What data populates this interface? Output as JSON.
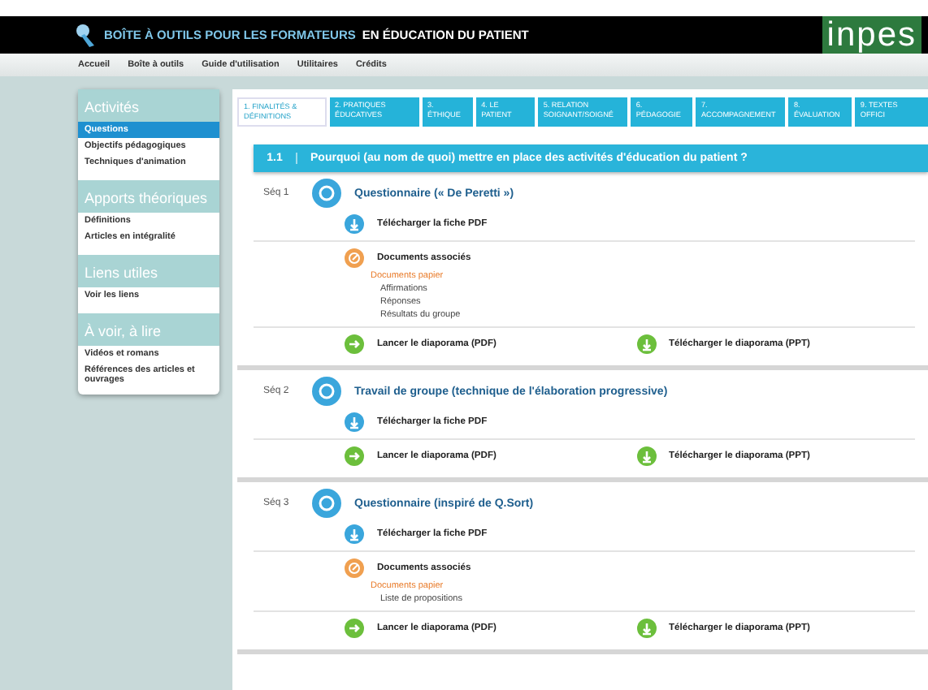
{
  "header": {
    "title_lead": "BOÎTE À OUTILS POUR LES FORMATEURS",
    "title_rest": "EN ÉDUCATION DU PATIENT",
    "logo": "inpes"
  },
  "nav": [
    "Accueil",
    "Boîte à outils",
    "Guide d'utilisation",
    "Utilitaires",
    "Crédits"
  ],
  "sidebar": [
    {
      "heading": "Activités",
      "items": [
        {
          "label": "Questions",
          "selected": true
        },
        {
          "label": "Objectifs pédagogiques",
          "selected": false
        },
        {
          "label": "Techniques d'animation",
          "selected": false
        }
      ]
    },
    {
      "heading": "Apports théoriques",
      "items": [
        {
          "label": "Définitions",
          "selected": false
        },
        {
          "label": "Articles en intégralité",
          "selected": false
        }
      ]
    },
    {
      "heading": "Liens utiles",
      "items": [
        {
          "label": "Voir les liens",
          "selected": false
        }
      ]
    },
    {
      "heading": "À voir, à lire",
      "items": [
        {
          "label": "Vidéos et romans",
          "selected": false
        },
        {
          "label": "Références des articles et ouvrages",
          "selected": false
        }
      ]
    }
  ],
  "tabs": [
    {
      "label": "1. FINALITÉS & DÉFINITIONS",
      "selected": true
    },
    {
      "label": "2. PRATIQUES ÉDUCATIVES",
      "selected": false
    },
    {
      "label": "3. ÉTHIQUE",
      "selected": false
    },
    {
      "label": "4. LE PATIENT",
      "selected": false
    },
    {
      "label": "5. RELATION SOIGNANT/SOIGNÉ",
      "selected": false
    },
    {
      "label": "6. PÉDAGOGIE",
      "selected": false
    },
    {
      "label": "7. ACCOMPAGNEMENT",
      "selected": false
    },
    {
      "label": "8. ÉVALUATION",
      "selected": false
    },
    {
      "label": "9. TEXTES OFFICI",
      "selected": false
    }
  ],
  "question": {
    "number": "1.1",
    "text": "Pourquoi (au nom de quoi) mettre en place des activités d'éducation du patient ?"
  },
  "sequences": [
    {
      "label": "Séq 1",
      "title": "Questionnaire (« De Peretti »)",
      "rows": [
        {
          "kind": "pdf",
          "label": "Télécharger la fiche PDF"
        },
        {
          "kind": "docs",
          "label": "Documents associés",
          "group": "Documents papier",
          "files": [
            "Affirmations",
            "Réponses",
            "Résultats du groupe"
          ]
        },
        {
          "kind": "slides",
          "launch": "Lancer le diaporama (PDF)",
          "download": "Télécharger le diaporama (PPT)"
        }
      ]
    },
    {
      "label": "Séq 2",
      "title": "Travail de groupe (technique de l'élaboration progressive)",
      "rows": [
        {
          "kind": "pdf",
          "label": "Télécharger la fiche PDF"
        },
        {
          "kind": "slides",
          "launch": "Lancer le diaporama (PDF)",
          "download": "Télécharger le diaporama (PPT)"
        }
      ]
    },
    {
      "label": "Séq 3",
      "title": "Questionnaire (inspiré de Q.Sort)",
      "rows": [
        {
          "kind": "pdf",
          "label": "Télécharger la fiche PDF"
        },
        {
          "kind": "docs",
          "label": "Documents associés",
          "group": "Documents papier",
          "files": [
            "Liste de propositions"
          ]
        },
        {
          "kind": "slides",
          "launch": "Lancer le diaporama (PDF)",
          "download": "Télécharger le diaporama (PPT)"
        }
      ]
    }
  ]
}
